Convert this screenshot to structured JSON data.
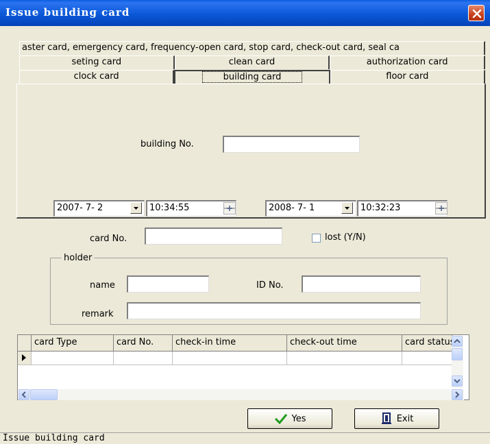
{
  "window": {
    "title": "Issue building card"
  },
  "tabs": {
    "row0": [
      "aster card, emergency card, frequency-open card, stop card, check-out card, seal ca"
    ],
    "row1": [
      "seting card",
      "clean card",
      "authorization card"
    ],
    "row2": [
      "clock card",
      "building card",
      "floor card"
    ],
    "selected": "building card"
  },
  "panel": {
    "building_label": "building No.",
    "building_value": "",
    "start_date": "2007- 7- 2",
    "start_time": "10:34:55",
    "end_date": "2008- 7- 1",
    "end_time": "10:32:23"
  },
  "card": {
    "label": "card No.",
    "value": "",
    "lost_label": "lost (Y/N)",
    "lost_checked": false
  },
  "holder": {
    "legend": "holder",
    "name_label": "name",
    "name_value": "",
    "id_label": "ID No.",
    "id_value": "",
    "remark_label": "remark",
    "remark_value": ""
  },
  "grid": {
    "columns": [
      "card Type",
      "card No.",
      "check-in time",
      "check-out time",
      "card status"
    ],
    "rows": []
  },
  "buttons": {
    "yes": "Yes",
    "exit": "Exit"
  },
  "status": "Issue building card",
  "colors": {
    "titlebar": "#0a5ce0",
    "close": "#c8401e",
    "face": "#ece9d8"
  }
}
